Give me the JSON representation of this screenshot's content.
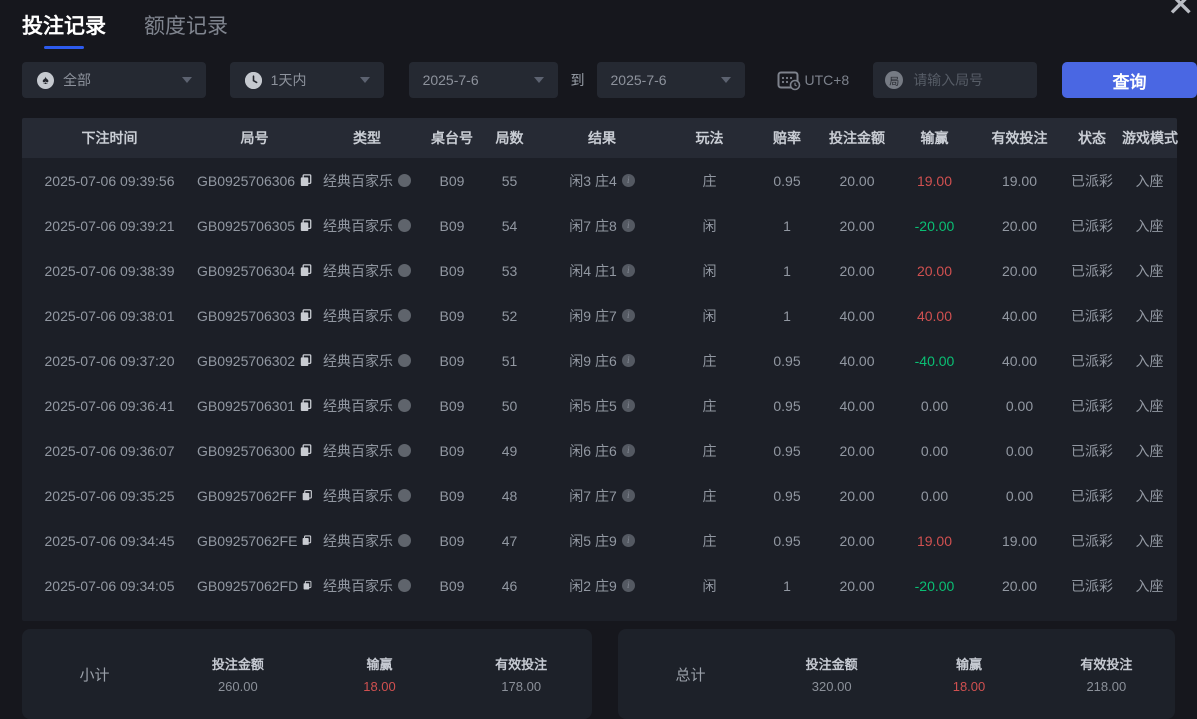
{
  "window": {
    "close_icon": "✕"
  },
  "tabs": [
    {
      "label": "投注记录",
      "active": true
    },
    {
      "label": "额度记录",
      "active": false
    }
  ],
  "filters": {
    "game_type": {
      "value": "全部",
      "icon": "spade-icon",
      "icon_glyph": "♠"
    },
    "time_range": {
      "value": "1天内",
      "icon": "clock-icon"
    },
    "date_from": "2025-7-6",
    "to_label": "到",
    "date_to": "2025-7-6",
    "timezone_label": "UTC+8",
    "round_input": {
      "placeholder": "请输入局号",
      "icon_char": "局"
    },
    "query_button_label": "查询"
  },
  "table": {
    "headers": [
      "下注时间",
      "局号",
      "类型",
      "桌台号",
      "局数",
      "结果",
      "玩法",
      "赔率",
      "投注金额",
      "输赢",
      "有效投注",
      "状态",
      "游戏模式"
    ],
    "rows": [
      {
        "time": "2025-07-06 09:39:56",
        "round_id": "GB0925706306",
        "type": "经典百家乐",
        "table_no": "B09",
        "round": "55",
        "result": "闲3 庄4",
        "play": "庄",
        "odds": "0.95",
        "bet": "20.00",
        "win_loss": "19.00",
        "win_loss_color": "red",
        "valid_bet": "19.00",
        "status": "已派彩",
        "mode": "入座"
      },
      {
        "time": "2025-07-06 09:39:21",
        "round_id": "GB0925706305",
        "type": "经典百家乐",
        "table_no": "B09",
        "round": "54",
        "result": "闲7 庄8",
        "play": "闲",
        "odds": "1",
        "bet": "20.00",
        "win_loss": "-20.00",
        "win_loss_color": "green",
        "valid_bet": "20.00",
        "status": "已派彩",
        "mode": "入座"
      },
      {
        "time": "2025-07-06 09:38:39",
        "round_id": "GB0925706304",
        "type": "经典百家乐",
        "table_no": "B09",
        "round": "53",
        "result": "闲4 庄1",
        "play": "闲",
        "odds": "1",
        "bet": "20.00",
        "win_loss": "20.00",
        "win_loss_color": "red",
        "valid_bet": "20.00",
        "status": "已派彩",
        "mode": "入座"
      },
      {
        "time": "2025-07-06 09:38:01",
        "round_id": "GB0925706303",
        "type": "经典百家乐",
        "table_no": "B09",
        "round": "52",
        "result": "闲9 庄7",
        "play": "闲",
        "odds": "1",
        "bet": "40.00",
        "win_loss": "40.00",
        "win_loss_color": "red",
        "valid_bet": "40.00",
        "status": "已派彩",
        "mode": "入座"
      },
      {
        "time": "2025-07-06 09:37:20",
        "round_id": "GB0925706302",
        "type": "经典百家乐",
        "table_no": "B09",
        "round": "51",
        "result": "闲9 庄6",
        "play": "庄",
        "odds": "0.95",
        "bet": "40.00",
        "win_loss": "-40.00",
        "win_loss_color": "green",
        "valid_bet": "40.00",
        "status": "已派彩",
        "mode": "入座"
      },
      {
        "time": "2025-07-06 09:36:41",
        "round_id": "GB0925706301",
        "type": "经典百家乐",
        "table_no": "B09",
        "round": "50",
        "result": "闲5 庄5",
        "play": "庄",
        "odds": "0.95",
        "bet": "40.00",
        "win_loss": "0.00",
        "win_loss_color": "gray",
        "valid_bet": "0.00",
        "status": "已派彩",
        "mode": "入座"
      },
      {
        "time": "2025-07-06 09:36:07",
        "round_id": "GB0925706300",
        "type": "经典百家乐",
        "table_no": "B09",
        "round": "49",
        "result": "闲6 庄6",
        "play": "庄",
        "odds": "0.95",
        "bet": "20.00",
        "win_loss": "0.00",
        "win_loss_color": "gray",
        "valid_bet": "0.00",
        "status": "已派彩",
        "mode": "入座"
      },
      {
        "time": "2025-07-06 09:35:25",
        "round_id": "GB09257062FF",
        "type": "经典百家乐",
        "table_no": "B09",
        "round": "48",
        "result": "闲7 庄7",
        "play": "庄",
        "odds": "0.95",
        "bet": "20.00",
        "win_loss": "0.00",
        "win_loss_color": "gray",
        "valid_bet": "0.00",
        "status": "已派彩",
        "mode": "入座"
      },
      {
        "time": "2025-07-06 09:34:45",
        "round_id": "GB09257062FE",
        "type": "经典百家乐",
        "table_no": "B09",
        "round": "47",
        "result": "闲5 庄9",
        "play": "庄",
        "odds": "0.95",
        "bet": "20.00",
        "win_loss": "19.00",
        "win_loss_color": "red",
        "valid_bet": "19.00",
        "status": "已派彩",
        "mode": "入座"
      },
      {
        "time": "2025-07-06 09:34:05",
        "round_id": "GB09257062FD",
        "type": "经典百家乐",
        "table_no": "B09",
        "round": "46",
        "result": "闲2 庄9",
        "play": "闲",
        "odds": "1",
        "bet": "20.00",
        "win_loss": "-20.00",
        "win_loss_color": "green",
        "valid_bet": "20.00",
        "status": "已派彩",
        "mode": "入座"
      }
    ]
  },
  "summary": {
    "subtotal": {
      "label": "小计",
      "bet_label": "投注金额",
      "bet_value": "260.00",
      "winloss_label": "输赢",
      "winloss_value": "18.00",
      "valid_label": "有效投注",
      "valid_value": "178.00"
    },
    "total": {
      "label": "总计",
      "bet_label": "投注金额",
      "bet_value": "320.00",
      "winloss_label": "输赢",
      "winloss_value": "18.00",
      "valid_label": "有效投注",
      "valid_value": "218.00"
    }
  },
  "colors": {
    "accent_blue": "#4a67e3",
    "tab_underline": "#2d5bee",
    "positive_red": "#d05050",
    "negative_green": "#0abf74",
    "page_bg": "#16171d",
    "panel_bg": "#1d2129",
    "header_bg": "#262a34"
  }
}
